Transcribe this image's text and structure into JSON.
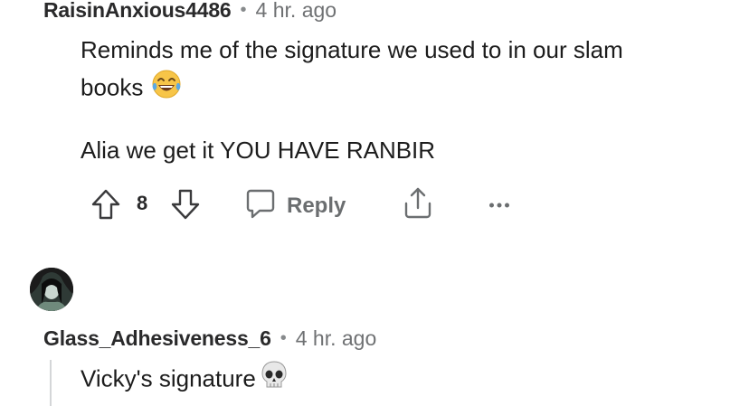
{
  "comments": [
    {
      "username": "RaisinAnxious4486",
      "separator": "•",
      "time": "4 hr. ago",
      "lines": [
        "Reminds me of the signature we used to in our slam",
        "books",
        "Alia we get it YOU HAVE RANBIR"
      ],
      "emoji": "face-with-tears-of-joy",
      "votes": "8",
      "actions": {
        "reply_label": "Reply",
        "more_label": "•••"
      }
    },
    {
      "username": "Glass_Adhesiveness_6",
      "separator": "•",
      "time": "4 hr. ago",
      "lines": [
        "Vicky's signature"
      ],
      "emoji": "skull"
    }
  ],
  "icons": {
    "upvote": "arrow-up-icon",
    "downvote": "arrow-down-icon",
    "reply": "speech-bubble-icon",
    "share": "share-icon",
    "more": "more-options-icon"
  },
  "colors": {
    "username": "#2a2a2b",
    "meta": "#6f7173",
    "action": "#6b6e70",
    "thread_line": "#d4d6d8"
  }
}
